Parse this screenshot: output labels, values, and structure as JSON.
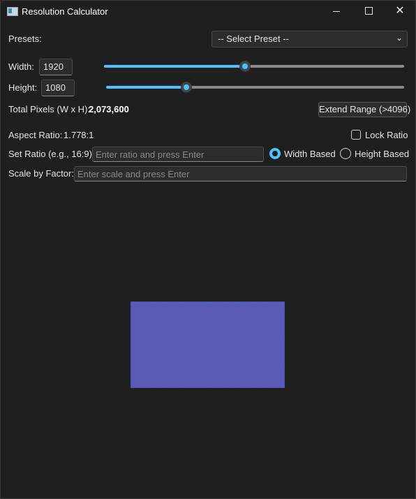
{
  "window": {
    "title": "Resolution Calculator"
  },
  "presets": {
    "label": "Presets:",
    "selected": "-- Select Preset --"
  },
  "width": {
    "label": "Width:",
    "value": "1920",
    "slider_fraction": 0.47
  },
  "height": {
    "label": "Height:",
    "value": "1080",
    "slider_fraction": 0.27
  },
  "total_pixels": {
    "label": "Total Pixels (W x H):",
    "value": "2,073,600"
  },
  "extend_range": {
    "label": "Extend Range (>4096)"
  },
  "aspect_ratio": {
    "label": "Aspect Ratio:",
    "value": "1.778:1"
  },
  "lock_ratio": {
    "label": "Lock Ratio",
    "checked": false
  },
  "set_ratio": {
    "label": "Set Ratio (e.g., 16:9):",
    "placeholder": "Enter ratio and press Enter"
  },
  "ratio_mode": {
    "width_based": "Width Based",
    "height_based": "Height Based",
    "selected": "width_based"
  },
  "scale": {
    "label": "Scale by Factor:",
    "placeholder": "Enter scale and press Enter"
  },
  "preview": {
    "color": "#5a5ab5",
    "border_color": "#3e55c9"
  },
  "colors": {
    "accent": "#4cc2ff",
    "background": "#1e1e1e"
  }
}
